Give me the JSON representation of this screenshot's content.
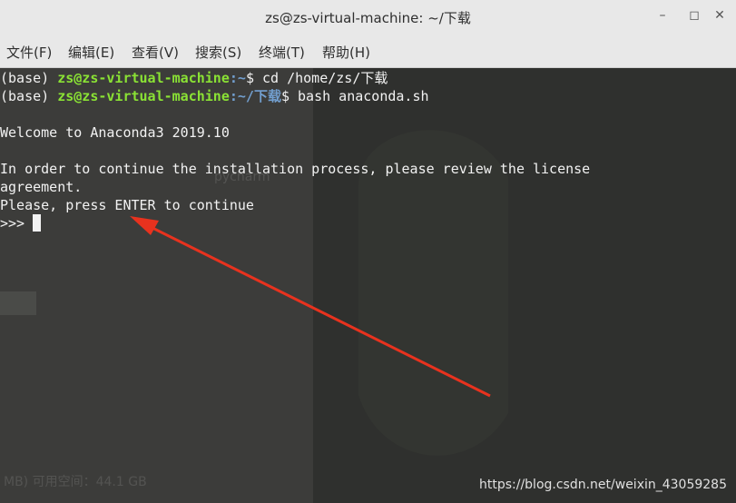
{
  "window": {
    "title": "zs@zs-virtual-machine: ~/下载"
  },
  "menu": [
    "文件(F)",
    "编辑(E)",
    "查看(V)",
    "搜索(S)",
    "终端(T)",
    "帮助(H)"
  ],
  "terminal": {
    "line1": {
      "env": "(base) ",
      "user": "zs@zs-virtual-machine",
      "path": ":~",
      "prompt": "$ ",
      "cmd": "cd /home/zs/下载"
    },
    "line2": {
      "env": "(base) ",
      "user": "zs@zs-virtual-machine",
      "path": ":~/下载",
      "prompt": "$ ",
      "cmd": "bash anaconda.sh"
    },
    "welcome": "Welcome to Anaconda3 2019.10",
    "license1": "In order to continue the installation process, please review the license",
    "license2": "agreement.",
    "press": "Please, press ENTER to continue",
    "prompt3": ">>> "
  },
  "background": {
    "faint1": "pycharm",
    "faint2": "MB) 可用空间：44.1 GB"
  },
  "watermark": "https://blog.csdn.net/weixin_43059285",
  "colors": {
    "arrow": "#e8321e",
    "user": "#8ae234",
    "path": "#729fcf"
  }
}
